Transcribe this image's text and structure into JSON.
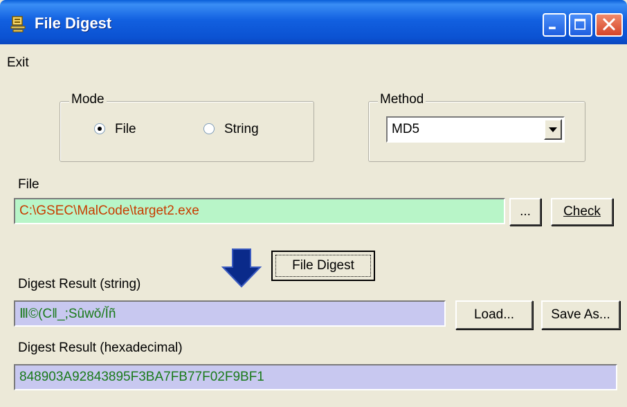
{
  "window": {
    "title": "File Digest"
  },
  "menu": {
    "exit_label": "Exit"
  },
  "mode": {
    "legend": "Mode",
    "options": [
      {
        "label": "File",
        "selected": true
      },
      {
        "label": "String",
        "selected": false
      }
    ]
  },
  "method": {
    "legend": "Method",
    "selected": "MD5"
  },
  "file": {
    "label": "File",
    "path": "C:\\GSEC\\MalCode\\target2.exe",
    "browse_label": "...",
    "check_label": "Check"
  },
  "actions": {
    "digest_label": "File Digest"
  },
  "digest_string": {
    "label": "Digest Result (string)",
    "value": "Ⅲ©(C‖_;Sûwǒ/Ĭñ",
    "load_label": "Load...",
    "save_label": "Save As..."
  },
  "digest_hex": {
    "label": "Digest Result (hexadecimal)",
    "value": "848903A92843895F3BA7FB77F02F9BF1"
  },
  "colors": {
    "titlebar": "#0b52d2",
    "file_field_bg": "#b8f5c8",
    "file_field_text": "#c83c00",
    "result_field_bg": "#c8c8f0",
    "result_text": "#1a7a1a",
    "arrow": "#0a2a8a"
  }
}
